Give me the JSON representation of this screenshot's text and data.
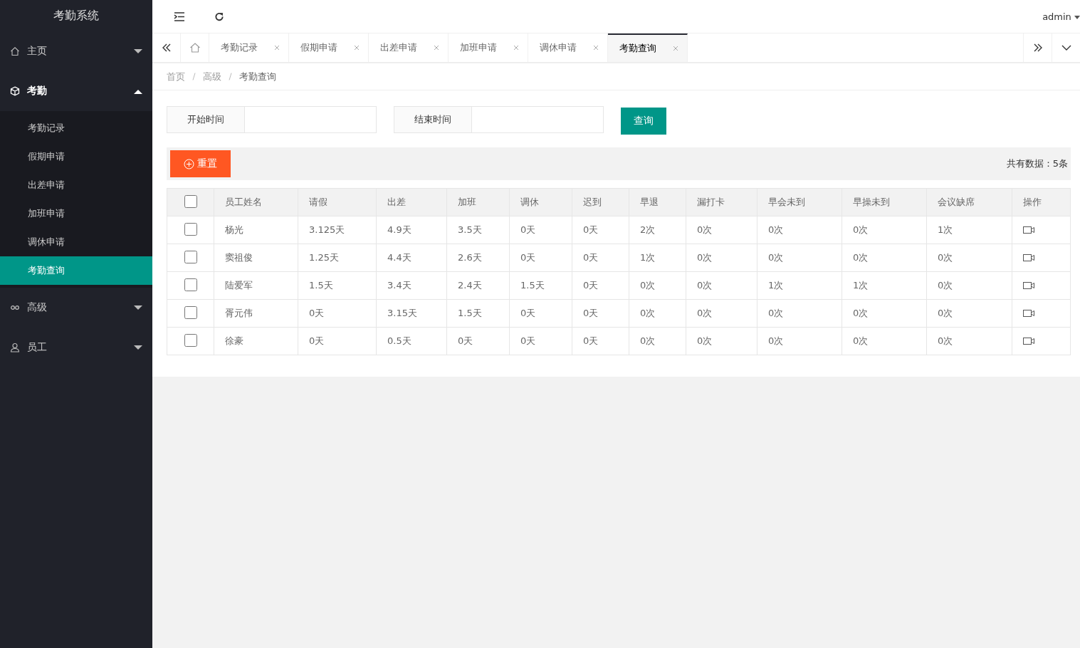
{
  "app_title": "考勤系统",
  "sidebar": {
    "items": [
      {
        "label": "主页",
        "expanded": false
      },
      {
        "label": "考勤",
        "expanded": true,
        "children": [
          {
            "label": "考勤记录",
            "selected": false
          },
          {
            "label": "假期申请",
            "selected": false
          },
          {
            "label": "出差申请",
            "selected": false
          },
          {
            "label": "加班申请",
            "selected": false
          },
          {
            "label": "调休申请",
            "selected": false
          },
          {
            "label": "考勤查询",
            "selected": true
          }
        ]
      },
      {
        "label": "高级",
        "expanded": false
      },
      {
        "label": "员工",
        "expanded": false
      }
    ]
  },
  "header": {
    "user": "admin"
  },
  "tabs": [
    {
      "label": "考勤记录",
      "selected": false
    },
    {
      "label": "假期申请",
      "selected": false
    },
    {
      "label": "出差申请",
      "selected": false
    },
    {
      "label": "加班申请",
      "selected": false
    },
    {
      "label": "调休申请",
      "selected": false
    },
    {
      "label": "考勤查询",
      "selected": true
    }
  ],
  "breadcrumb": [
    "首页",
    "高级",
    "考勤查询"
  ],
  "filters": [
    {
      "label": "开始时间"
    },
    {
      "label": "结束时间"
    }
  ],
  "search_button": "查询",
  "reset_button": "重置",
  "total": "共有数据：5条",
  "table": {
    "header_checked": false,
    "columns": [
      "员工姓名",
      "请假",
      "出差",
      "加班",
      "调休",
      "迟到",
      "早退",
      "漏打卡",
      "早会未到",
      "早操未到",
      "会议缺席",
      "操作"
    ],
    "rows": [
      {
        "checked": false,
        "cells": [
          "杨光",
          "3.125天",
          "4.9天",
          "3.5天",
          "0天",
          "0天",
          "2次",
          "0次",
          "0次",
          "0次",
          "1次"
        ]
      },
      {
        "checked": false,
        "cells": [
          "窦祖俊",
          "1.25天",
          "4.4天",
          "2.6天",
          "0天",
          "0天",
          "1次",
          "0次",
          "0次",
          "0次",
          "0次"
        ]
      },
      {
        "checked": false,
        "cells": [
          "陆爱军",
          "1.5天",
          "3.4天",
          "2.4天",
          "1.5天",
          "0天",
          "0次",
          "0次",
          "1次",
          "1次",
          "0次"
        ]
      },
      {
        "checked": false,
        "cells": [
          "胥元伟",
          "0天",
          "3.15天",
          "1.5天",
          "0天",
          "0天",
          "0次",
          "0次",
          "0次",
          "0次",
          "0次"
        ]
      },
      {
        "checked": false,
        "cells": [
          "徐豪",
          "0天",
          "0.5天",
          "0天",
          "0天",
          "0天",
          "0次",
          "0次",
          "0次",
          "0次",
          "0次"
        ]
      }
    ]
  }
}
